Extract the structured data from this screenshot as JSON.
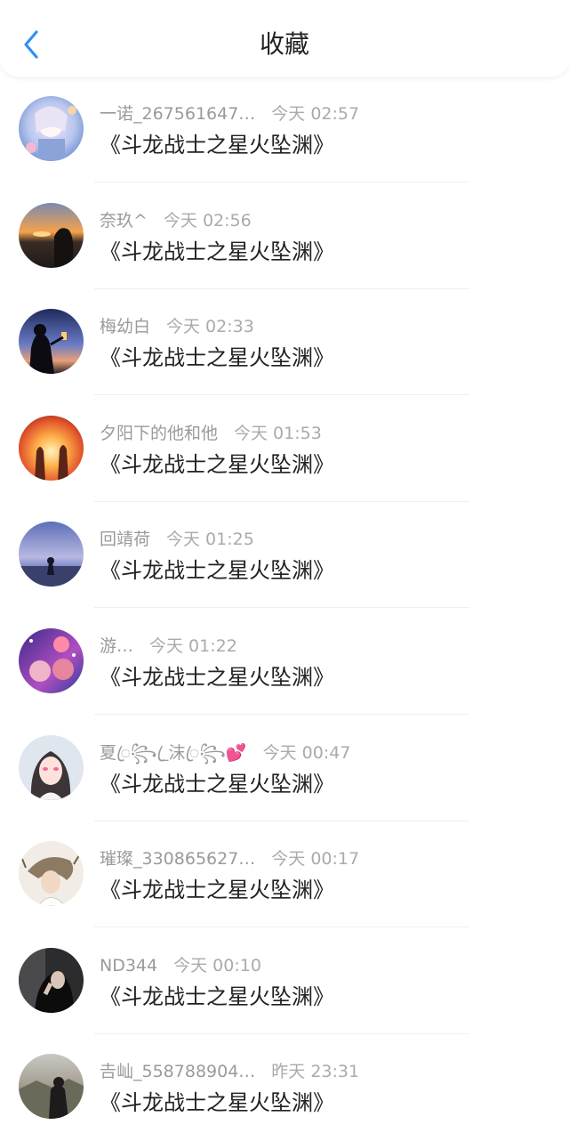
{
  "header": {
    "title": "收藏",
    "back_icon": "chevron-left-icon",
    "accent": "#2f8ff5"
  },
  "items": [
    {
      "name": "一诺_267561647…",
      "time": "今天 02:57",
      "work": "《斗龙战士之星火坠渊》"
    },
    {
      "name": "奈玖^",
      "time": "今天 02:56",
      "work": "《斗龙战士之星火坠渊》"
    },
    {
      "name": "梅幼白",
      "time": "今天 02:33",
      "work": "《斗龙战士之星火坠渊》"
    },
    {
      "name": "夕阳下的他和他",
      "time": "今天 01:53",
      "work": "《斗龙战士之星火坠渊》"
    },
    {
      "name": "回靖荷",
      "time": "今天 01:25",
      "work": "《斗龙战士之星火坠渊》"
    },
    {
      "name": "游…",
      "time": "今天 01:22",
      "work": "《斗龙战士之星火坠渊》"
    },
    {
      "name": "夏ꦿ꧂_ꦿ沫ꦿ꧂💕",
      "time": "今天 00:47",
      "work": "《斗龙战士之星火坠渊》"
    },
    {
      "name": "璀璨_330865627…",
      "time": "今天 00:17",
      "work": "《斗龙战士之星火坠渊》"
    },
    {
      "name": "ND344",
      "time": "今天 00:10",
      "work": "《斗龙战士之星火坠渊》"
    },
    {
      "name": "𠮷屾_558788904…",
      "time": "昨天 23:31",
      "work": "《斗龙战士之星火坠渊》"
    }
  ]
}
